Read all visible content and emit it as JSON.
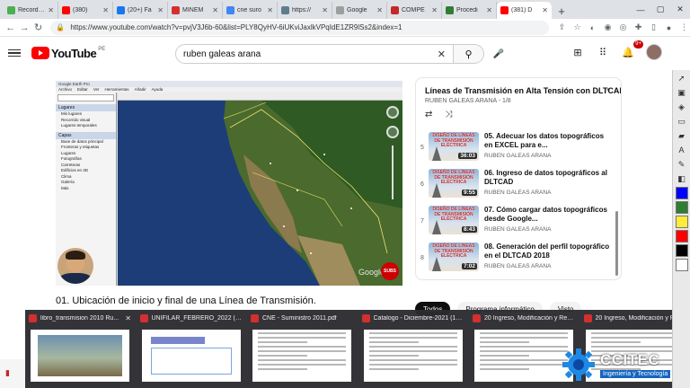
{
  "browser": {
    "tabs": [
      {
        "title": "Recordings",
        "color": "#4caf50",
        "active": false
      },
      {
        "title": "(380)",
        "color": "#ff0000",
        "active": false
      },
      {
        "title": "(20+) Fa",
        "color": "#1877f2",
        "active": false
      },
      {
        "title": "MINEM",
        "color": "#d32f2f",
        "active": false
      },
      {
        "title": "cne suro",
        "color": "#4285f4",
        "active": false
      },
      {
        "title": "https://",
        "color": "#607d8b",
        "active": false
      },
      {
        "title": "Google",
        "color": "#9e9e9e",
        "active": false
      },
      {
        "title": "COMPE",
        "color": "#c62828",
        "active": false
      },
      {
        "title": "Procedi",
        "color": "#2e7d32",
        "active": false
      },
      {
        "title": "(381) D",
        "color": "#ff0000",
        "active": true
      }
    ],
    "new_tab": "+",
    "url": "https://www.youtube.com/watch?v=pvjV3J6b-60&list=PLY8QyHV-6iUKviJaxlkVPqIdE1ZR9lSs2&index=1"
  },
  "youtube": {
    "logo_text": "YouTube",
    "country_code": "PE",
    "search_value": "ruben galeas arana",
    "notification_count": "9+"
  },
  "video": {
    "title": "01. Ubicación de inicio y final de una Línea de Transmisión.",
    "screen": {
      "app_title": "Google Earth Pro",
      "menu": [
        "Archivo",
        "Editar",
        "Ver",
        "Herramientas",
        "Añadir",
        "Ayuda"
      ],
      "places_header": "Lugares",
      "places": [
        "Mis lugares",
        "Recorrido visual",
        "Lugares temporales"
      ],
      "layers_header": "Capas",
      "layers": [
        "Base de datos principal",
        "Fronteras y etiquetas",
        "Lugares",
        "Fotografías",
        "Carreteras",
        "Edificios en 3D",
        "Clima",
        "Galería",
        "Más"
      ],
      "watermark": "Google",
      "channel_badge": "SUBS"
    }
  },
  "playlist": {
    "title": "Líneas de Transmisión en Alta Tensión con DLTCAD",
    "subtitle": "RUBEN GALEAS ARANA - 1/8",
    "thumb_label": "DISEÑO DE LÍNEAS DE TRANSMISIÓN ELÉCTRICA",
    "items": [
      {
        "index": "5",
        "title": "05. Adecuar los datos topográficos en EXCEL para e...",
        "channel": "RUBEN GALEAS ARANA",
        "duration": "36:03"
      },
      {
        "index": "6",
        "title": "06. Ingreso de datos topográficos al DLTCAD",
        "channel": "RUBEN GALEAS ARANA",
        "duration": "9:55"
      },
      {
        "index": "7",
        "title": "07. Cómo cargar datos topográficos desde Google...",
        "channel": "RUBEN GALEAS ARANA",
        "duration": "8:43"
      },
      {
        "index": "8",
        "title": "08. Generación del perfil topográfico en el DLTCAD 2018",
        "channel": "RUBEN GALEAS ARANA",
        "duration": "7:02"
      }
    ]
  },
  "chips": [
    "Todos",
    "Programa informático",
    "Visto"
  ],
  "taskbar_previews": [
    {
      "title": "libro_transmision 2010 Ru...",
      "icon_color": "#d32f2f",
      "kind": "photo"
    },
    {
      "title": "UNIFILAR_FEBRERO_2022 (1).pdf",
      "icon_color": "#d32f2f",
      "kind": "diagram"
    },
    {
      "title": "CNE - Suministro 2011.pdf",
      "icon_color": "#d32f2f",
      "kind": "doc"
    },
    {
      "title": "Catalogo - Diciembre-2021 (1)....",
      "icon_color": "#d32f2f",
      "kind": "doc"
    },
    {
      "title": "20 Ingreso, Modificación y Retir...",
      "icon_color": "#d32f2f",
      "kind": "doc"
    },
    {
      "title": "20 Ingreso, Modificación y Retir...",
      "icon_color": "#d32f2f",
      "kind": "doc"
    }
  ],
  "logo": {
    "name": "CCITEC",
    "tagline": "Ingeniería y Tecnología"
  },
  "side_tool_colors": [
    "#0000ff",
    "#2e7d32",
    "#ffeb3b",
    "#ff0000",
    "#000000",
    "#ffffff"
  ]
}
